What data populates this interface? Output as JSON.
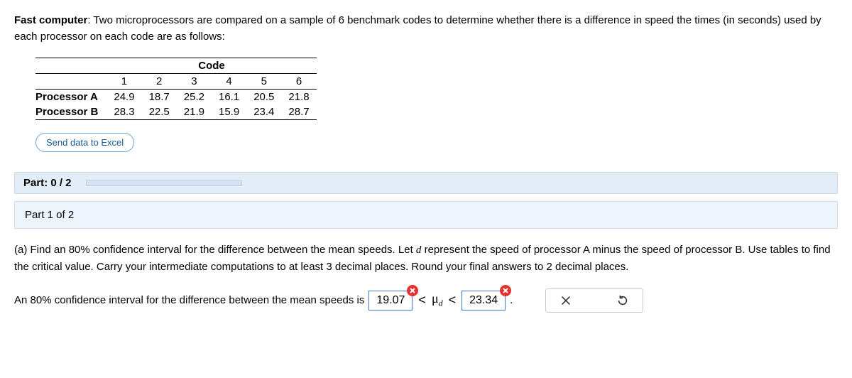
{
  "prompt": {
    "lead": "Fast computer",
    "text": ": Two microprocessors are compared on a sample of 6 benchmark codes to determine whether there is a difference in speed the times (in seconds) used by each processor on each code are as follows:"
  },
  "table": {
    "codeLabel": "Code",
    "cols": [
      "1",
      "2",
      "3",
      "4",
      "5",
      "6"
    ],
    "rows": [
      {
        "label": "Processor A",
        "vals": [
          "24.9",
          "18.7",
          "25.2",
          "16.1",
          "20.5",
          "21.8"
        ]
      },
      {
        "label": "Processor B",
        "vals": [
          "28.3",
          "22.5",
          "21.9",
          "15.9",
          "23.4",
          "28.7"
        ]
      }
    ]
  },
  "sendBtn": "Send data to Excel",
  "partBar": "Part: 0 / 2",
  "progressPct": 0,
  "subPart": "Part 1 of 2",
  "question": {
    "a": "(a) Find an 80% confidence interval for the difference between the mean speeds. Let ",
    "dvar": "d",
    "b": " represent the speed of processor A minus the speed of processor B. Use tables to find the critical value. Carry your intermediate computations to at least 3 decimal places. Round your final answers to 2 decimal places."
  },
  "answer": {
    "pre": "An 80% confidence interval for the difference between the mean speeds is",
    "lower": "19.07",
    "upper": "23.34",
    "mid": "μ",
    "sub": "d",
    "period": "."
  }
}
